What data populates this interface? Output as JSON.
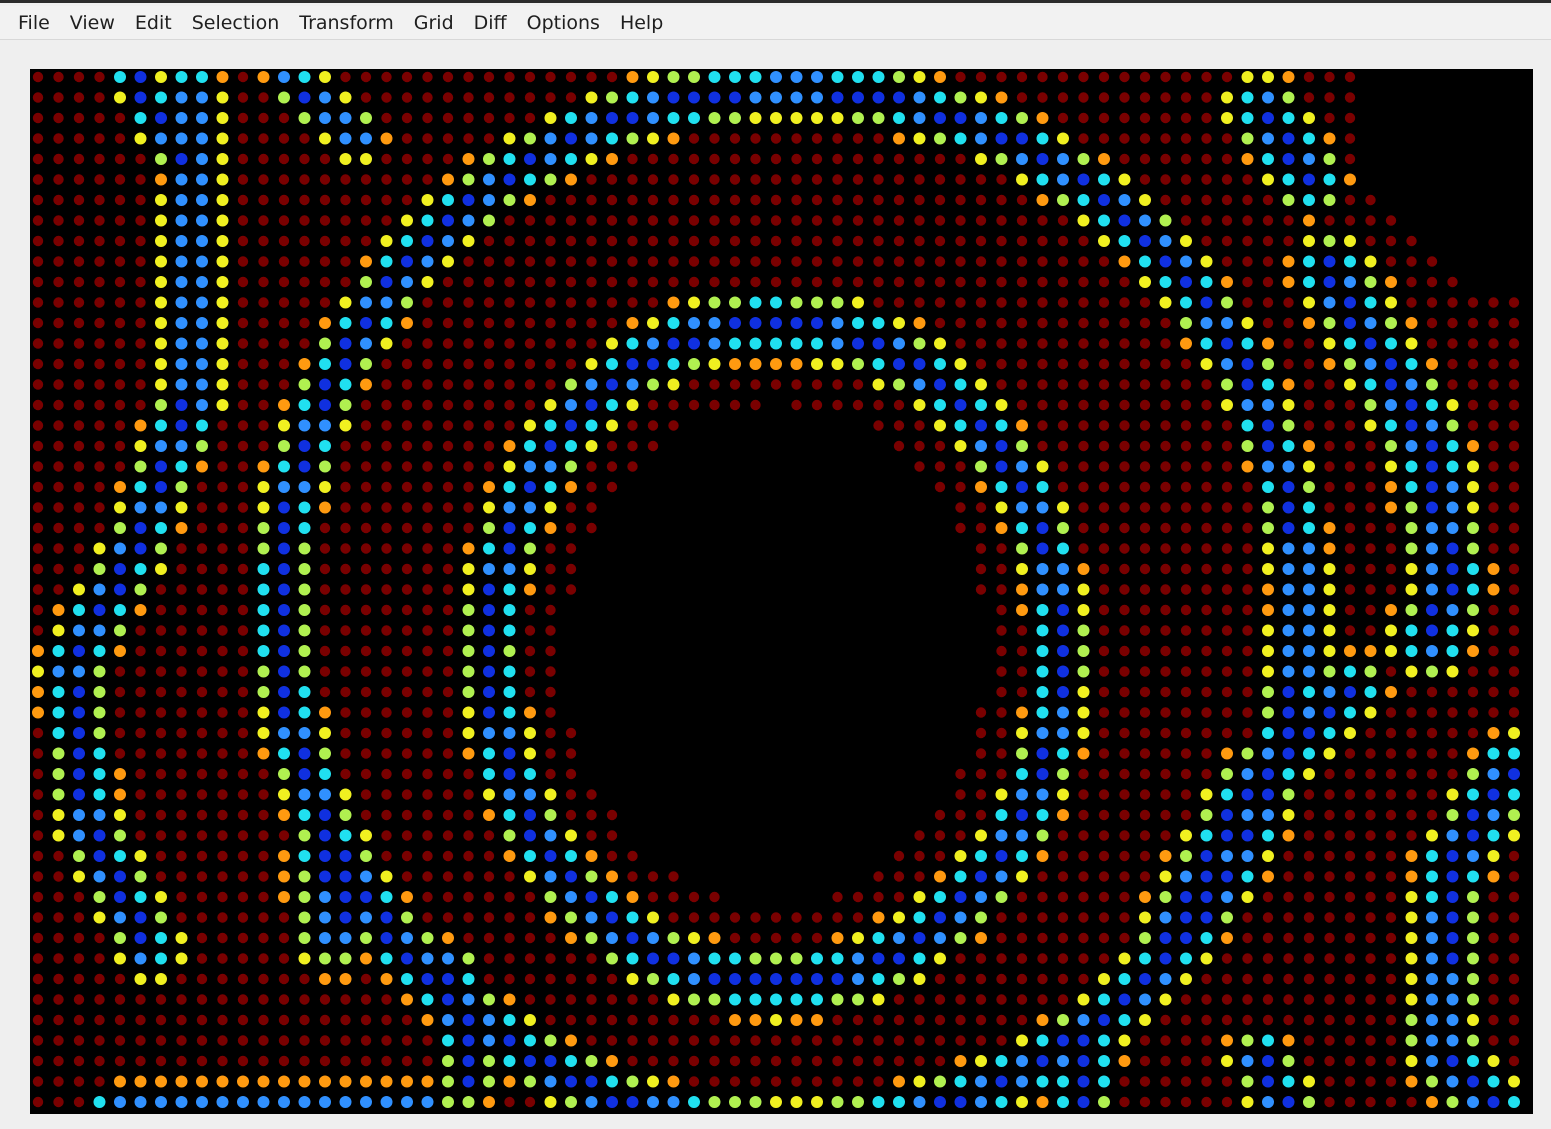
{
  "menubar": {
    "items": [
      {
        "id": "file",
        "label": "File"
      },
      {
        "id": "view",
        "label": "View"
      },
      {
        "id": "edit",
        "label": "Edit"
      },
      {
        "id": "selection",
        "label": "Selection"
      },
      {
        "id": "transform",
        "label": "Transform"
      },
      {
        "id": "grid",
        "label": "Grid"
      },
      {
        "id": "diff",
        "label": "Diff"
      },
      {
        "id": "options",
        "label": "Options"
      },
      {
        "id": "help",
        "label": "Help"
      }
    ]
  },
  "canvas": {
    "background": "#000000",
    "colormap": "jet",
    "colors": {
      "dark_red": "#7a0000",
      "red": "#e01a10",
      "orange": "#ff9a10",
      "yellow": "#f0f020",
      "green_yellow": "#b0f050",
      "cyan": "#20e0f0",
      "light_blue": "#3090ff",
      "blue": "#1030e0",
      "dark_blue": "#0818a0"
    }
  }
}
